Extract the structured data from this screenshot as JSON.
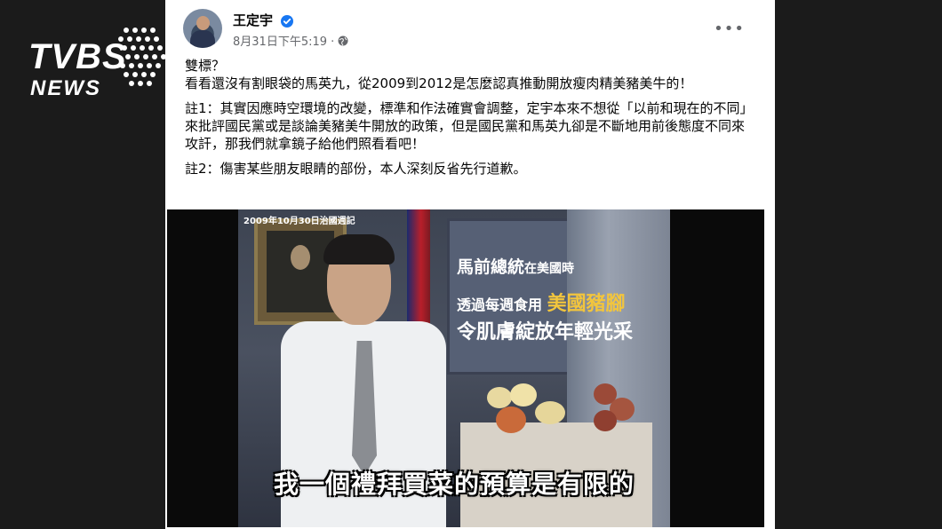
{
  "watermark": {
    "main": "TVBS",
    "sub": "NEWS"
  },
  "post": {
    "author": "王定宇",
    "timestamp": "8月31日下午5:19 ·",
    "paragraphs": [
      "雙標？\n看看還沒有割眼袋的馬英九，從2009到2012是怎麼認真推動開放瘦肉精美豬美牛的！",
      "註1：其實因應時空環境的改變，標準和作法確實會調整，定宇本來不想從「以前和現在的不同」來批評國民黨或是談論美豬美牛開放的政策，但是國民黨和馬英九卻是不斷地用前後態度不同來攻訐，那我們就拿鏡子給他們照看看吧！",
      "註2：傷害某些朋友眼睛的部份，本人深刻反省先行道歉。"
    ]
  },
  "video": {
    "date_label": "2009年10月30日治國週記",
    "caption1_big": "馬前總統",
    "caption1_small": "在美國時",
    "caption2_plain": "透過每週食用",
    "caption2_highlight": "美國豬腳",
    "caption3": "令肌膚綻放年輕光采",
    "subtitle": "我一個禮拜買菜的預算是有限的"
  },
  "colors": {
    "accent_verified": "#1877f2",
    "highlight": "#f2c53d"
  }
}
